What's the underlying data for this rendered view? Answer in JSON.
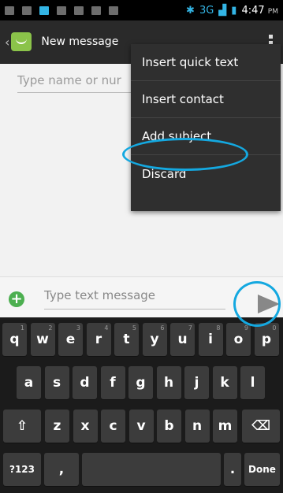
{
  "status_bar": {
    "network": "3G",
    "time": "4:47",
    "ampm": "PM"
  },
  "action_bar": {
    "title": "New message"
  },
  "compose": {
    "to_placeholder": "Type name or nur",
    "message_placeholder": "Type text message"
  },
  "menu": {
    "items": [
      "Insert quick text",
      "Insert contact",
      "Add subject",
      "Discard"
    ]
  },
  "keyboard": {
    "row1": [
      {
        "k": "q",
        "n": "1"
      },
      {
        "k": "w",
        "n": "2"
      },
      {
        "k": "e",
        "n": "3"
      },
      {
        "k": "r",
        "n": "4"
      },
      {
        "k": "t",
        "n": "5"
      },
      {
        "k": "y",
        "n": "6"
      },
      {
        "k": "u",
        "n": "7"
      },
      {
        "k": "i",
        "n": "8"
      },
      {
        "k": "o",
        "n": "9"
      },
      {
        "k": "p",
        "n": "0"
      }
    ],
    "row2": [
      "a",
      "s",
      "d",
      "f",
      "g",
      "h",
      "j",
      "k",
      "l"
    ],
    "row3": [
      "z",
      "x",
      "c",
      "v",
      "b",
      "n",
      "m"
    ],
    "shift": "⇧",
    "backspace": "⌫",
    "symbols": "?123",
    "comma": ",",
    "period": ".",
    "done": "Done"
  }
}
